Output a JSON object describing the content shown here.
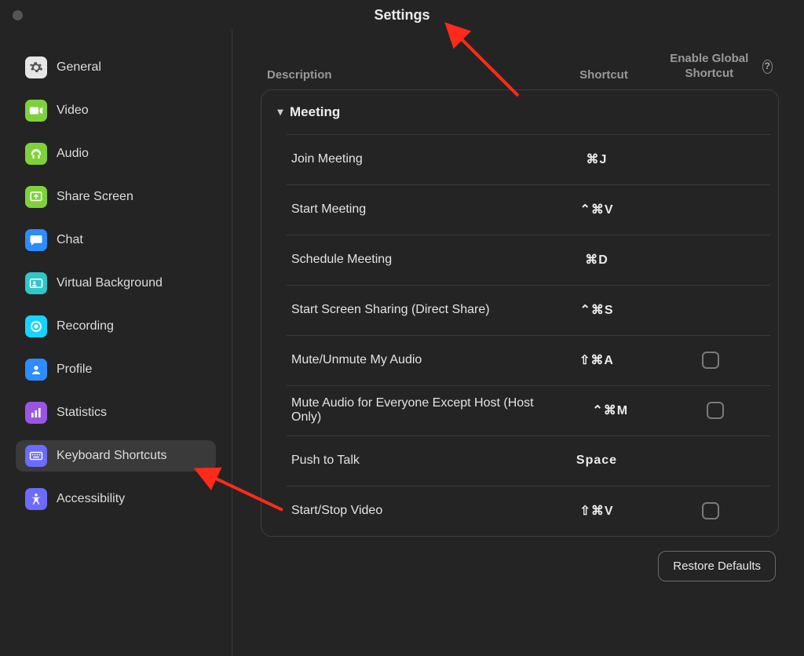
{
  "window": {
    "title": "Settings"
  },
  "sidebar": {
    "items": [
      {
        "label": "General",
        "icon": "gear-icon",
        "bg": "bg-gray"
      },
      {
        "label": "Video",
        "icon": "video-icon",
        "bg": "bg-green"
      },
      {
        "label": "Audio",
        "icon": "headphones-icon",
        "bg": "bg-green"
      },
      {
        "label": "Share Screen",
        "icon": "share-screen-icon",
        "bg": "bg-green"
      },
      {
        "label": "Chat",
        "icon": "chat-icon",
        "bg": "bg-blue"
      },
      {
        "label": "Virtual Background",
        "icon": "person-card-icon",
        "bg": "bg-teal"
      },
      {
        "label": "Recording",
        "icon": "record-icon",
        "bg": "bg-cyan"
      },
      {
        "label": "Profile",
        "icon": "profile-icon",
        "bg": "bg-blue"
      },
      {
        "label": "Statistics",
        "icon": "stats-icon",
        "bg": "bg-violet"
      },
      {
        "label": "Keyboard Shortcuts",
        "icon": "keyboard-icon",
        "bg": "bg-indigo",
        "active": true
      },
      {
        "label": "Accessibility",
        "icon": "accessibility-icon",
        "bg": "bg-indigo"
      }
    ]
  },
  "columns": {
    "description": "Description",
    "shortcut": "Shortcut",
    "global": "Enable Global Shortcut"
  },
  "panel": {
    "section": {
      "title": "Meeting",
      "expanded": true,
      "rows": [
        {
          "desc": "Join Meeting",
          "shortcut": "⌘J",
          "hasGlobal": false
        },
        {
          "desc": "Start Meeting",
          "shortcut": "⌃⌘V",
          "hasGlobal": false
        },
        {
          "desc": "Schedule Meeting",
          "shortcut": "⌘D",
          "hasGlobal": false
        },
        {
          "desc": "Start Screen Sharing (Direct Share)",
          "shortcut": "⌃⌘S",
          "hasGlobal": false
        },
        {
          "desc": "Mute/Unmute My Audio",
          "shortcut": "⇧⌘A",
          "hasGlobal": true,
          "globalChecked": false
        },
        {
          "desc": "Mute Audio for Everyone Except Host (Host Only)",
          "shortcut": "⌃⌘M",
          "hasGlobal": true,
          "globalChecked": false
        },
        {
          "desc": "Push to Talk",
          "shortcut": "Space",
          "hasGlobal": false
        },
        {
          "desc": "Start/Stop Video",
          "shortcut": "⇧⌘V",
          "hasGlobal": true,
          "globalChecked": false
        }
      ]
    }
  },
  "footer": {
    "restore": "Restore Defaults"
  }
}
